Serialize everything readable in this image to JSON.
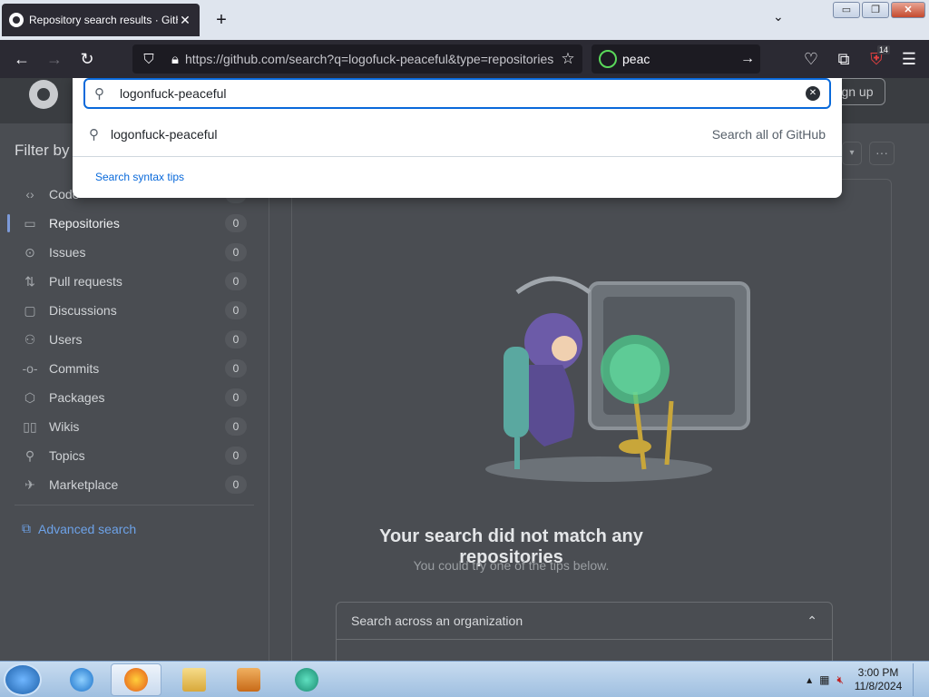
{
  "browser": {
    "tab_title": "Repository search results · GitHub",
    "tab_close": "✕",
    "new_tab": "+",
    "tab_list": "⌄",
    "url": "https://github.com/search?q=logofuck-peaceful&type=repositories",
    "search_query": "peac",
    "extension_badge": "14"
  },
  "window_controls": {
    "minimize": "▭",
    "restore": "❐",
    "close": "✕"
  },
  "header": {
    "signup_label": "Sign up"
  },
  "sidebar": {
    "filter_title": "Filter by",
    "items": [
      {
        "label": "Code",
        "count": "...",
        "icon": "‹›"
      },
      {
        "label": "Repositories",
        "count": "0",
        "icon": "▭"
      },
      {
        "label": "Issues",
        "count": "0",
        "icon": "⊙"
      },
      {
        "label": "Pull requests",
        "count": "0",
        "icon": "⇅"
      },
      {
        "label": "Discussions",
        "count": "0",
        "icon": "▢"
      },
      {
        "label": "Users",
        "count": "0",
        "icon": "⚇"
      },
      {
        "label": "Commits",
        "count": "0",
        "icon": "-o-"
      },
      {
        "label": "Packages",
        "count": "0",
        "icon": "⬡"
      },
      {
        "label": "Wikis",
        "count": "0",
        "icon": "▯▯"
      },
      {
        "label": "Topics",
        "count": "0",
        "icon": "⚲"
      },
      {
        "label": "Marketplace",
        "count": "0",
        "icon": "✈"
      }
    ],
    "advanced_search": "Advanced search"
  },
  "results": {
    "empty_title": "Your search did not match any repositories",
    "empty_hint": "You could try one of the tips below.",
    "accordion_label": "Search across an organization"
  },
  "search_overlay": {
    "input_value": "logonfuck-peaceful",
    "suggestion": "logonfuck-peaceful",
    "suggestion_hint": "Search all of GitHub",
    "tips": "Search syntax tips"
  },
  "taskbar": {
    "time": "3:00 PM",
    "date": "11/8/2024"
  }
}
